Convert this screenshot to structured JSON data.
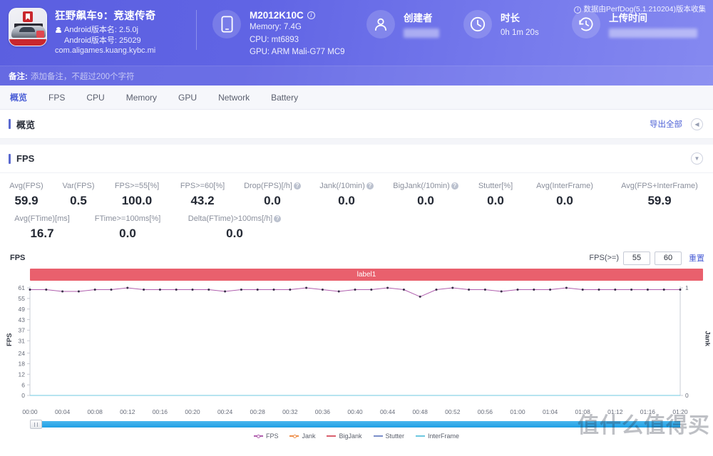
{
  "header": {
    "app_name": "狂野飙车9：竞速传奇",
    "android_version_name_line": "Android版本名: 2.5.0j",
    "android_version_code_line": "Android版本号: 25029",
    "package": "com.aligames.kuang.kybc.mi",
    "device": {
      "model": "M2012K10C",
      "memory": "Memory: 7.4G",
      "cpu": "CPU: mt6893",
      "gpu": "GPU: ARM Mali-G77 MC9"
    },
    "creator": {
      "title": "创建者",
      "value": ""
    },
    "duration": {
      "title": "时长",
      "value": "0h 1m 20s"
    },
    "upload": {
      "title": "上传时间",
      "value": ""
    },
    "perfdog_note": "数据由PerfDog(5.1.210204)版本收集",
    "note_label": "备注:",
    "note_placeholder": "添加备注，不超过200个字符"
  },
  "tabs": [
    {
      "label": "概览",
      "active": true
    },
    {
      "label": "FPS",
      "active": false
    },
    {
      "label": "CPU",
      "active": false
    },
    {
      "label": "Memory",
      "active": false
    },
    {
      "label": "GPU",
      "active": false
    },
    {
      "label": "Network",
      "active": false
    },
    {
      "label": "Battery",
      "active": false
    }
  ],
  "overview_panel": {
    "title": "概览",
    "export_all": "导出全部",
    "collapse_icon": "chevron-left-icon"
  },
  "fps_panel": {
    "title": "FPS",
    "collapse_icon": "chevron-down-icon"
  },
  "metrics": [
    {
      "label": "Avg(FPS)",
      "value": "59.9",
      "help": false
    },
    {
      "label": "Var(FPS)",
      "value": "0.5",
      "help": false
    },
    {
      "label": "FPS>=55[%]",
      "value": "100.0",
      "help": false
    },
    {
      "label": "FPS>=60[%]",
      "value": "43.2",
      "help": false
    },
    {
      "label": "Drop(FPS)[/h]",
      "value": "0.0",
      "help": true
    },
    {
      "label": "Jank(/10min)",
      "value": "0.0",
      "help": true
    },
    {
      "label": "BigJank(/10min)",
      "value": "0.0",
      "help": true
    },
    {
      "label": "Stutter[%]",
      "value": "0.0",
      "help": false
    },
    {
      "label": "Avg(InterFrame)",
      "value": "0.0",
      "help": false
    },
    {
      "label": "Avg(FPS+InterFrame)",
      "value": "59.9",
      "help": false
    }
  ],
  "metrics2": [
    {
      "label": "Avg(FTime)[ms]",
      "value": "16.7",
      "help": false
    },
    {
      "label": "FTime>=100ms[%]",
      "value": "0.0",
      "help": false
    },
    {
      "label": "Delta(FTime)>100ms[/h]",
      "value": "0.0",
      "help": true
    }
  ],
  "chart_controls": {
    "chart_label": "FPS",
    "threshold_label": "FPS(>=)",
    "threshold_1": "55",
    "threshold_2": "60",
    "reset": "重置",
    "band_label": "label1"
  },
  "watermark": "值什么值得买",
  "chart_data": {
    "type": "line",
    "title": "FPS",
    "xlabel": "",
    "ylabel": "FPS",
    "y2label": "Jank",
    "ylim": [
      0,
      61
    ],
    "y2lim": [
      0,
      1
    ],
    "yticks": [
      0,
      6,
      12,
      18,
      24,
      31,
      37,
      43,
      49,
      55,
      61
    ],
    "y2ticks": [
      0,
      1
    ],
    "grid": false,
    "legend_position": "bottom",
    "xticks": [
      "00:00",
      "00:04",
      "00:08",
      "00:12",
      "00:16",
      "00:20",
      "00:24",
      "00:28",
      "00:32",
      "00:36",
      "00:40",
      "00:44",
      "00:48",
      "00:52",
      "00:56",
      "01:00",
      "01:04",
      "01:08",
      "01:12",
      "01:16",
      "01:20"
    ],
    "x": [
      0,
      2,
      4,
      6,
      8,
      10,
      12,
      14,
      16,
      18,
      20,
      22,
      24,
      26,
      28,
      30,
      32,
      34,
      36,
      38,
      40,
      42,
      44,
      46,
      48,
      50,
      52,
      54,
      56,
      58,
      60,
      62,
      64,
      66,
      68,
      70,
      72,
      74,
      76,
      78,
      80
    ],
    "series": [
      {
        "name": "FPS",
        "color": "#b05fae",
        "values": [
          60,
          60,
          59,
          59,
          60,
          60,
          61,
          60,
          60,
          60,
          60,
          60,
          59,
          60,
          60,
          60,
          60,
          61,
          60,
          59,
          60,
          60,
          61,
          60,
          56,
          60,
          61,
          60,
          60,
          59,
          60,
          60,
          60,
          61,
          60,
          60,
          60,
          60,
          60,
          60,
          60
        ]
      },
      {
        "name": "Jank",
        "color": "#ee8f4a",
        "values": [
          0,
          0,
          0,
          0,
          0,
          0,
          0,
          0,
          0,
          0,
          0,
          0,
          0,
          0,
          0,
          0,
          0,
          0,
          0,
          0,
          0,
          0,
          0,
          0,
          0,
          0,
          0,
          0,
          0,
          0,
          0,
          0,
          0,
          0,
          0,
          0,
          0,
          0,
          0,
          0,
          0
        ]
      },
      {
        "name": "BigJank",
        "color": "#d9606e",
        "values": [
          0,
          0,
          0,
          0,
          0,
          0,
          0,
          0,
          0,
          0,
          0,
          0,
          0,
          0,
          0,
          0,
          0,
          0,
          0,
          0,
          0,
          0,
          0,
          0,
          0,
          0,
          0,
          0,
          0,
          0,
          0,
          0,
          0,
          0,
          0,
          0,
          0,
          0,
          0,
          0,
          0
        ]
      },
      {
        "name": "Stutter",
        "color": "#7b8fc9",
        "values": [
          0,
          0,
          0,
          0,
          0,
          0,
          0,
          0,
          0,
          0,
          0,
          0,
          0,
          0,
          0,
          0,
          0,
          0,
          0,
          0,
          0,
          0,
          0,
          0,
          0,
          0,
          0,
          0,
          0,
          0,
          0,
          0,
          0,
          0,
          0,
          0,
          0,
          0,
          0,
          0,
          0
        ]
      },
      {
        "name": "InterFrame",
        "color": "#6ec8e0",
        "values": [
          0,
          0,
          0,
          0,
          0,
          0,
          0,
          0,
          0,
          0,
          0,
          0,
          0,
          0,
          0,
          0,
          0,
          0,
          0,
          0,
          0,
          0,
          0,
          0,
          0,
          0,
          0,
          0,
          0,
          0,
          0,
          0,
          0,
          0,
          0,
          0,
          0,
          0,
          0,
          0,
          0
        ]
      }
    ],
    "legend": [
      {
        "name": "FPS",
        "color": "#b05fae",
        "marker": "line-dot"
      },
      {
        "name": "Jank",
        "color": "#ee8f4a",
        "marker": "line-dot"
      },
      {
        "name": "BigJank",
        "color": "#d9606e",
        "marker": "line"
      },
      {
        "name": "Stutter",
        "color": "#7b8fc9",
        "marker": "line"
      },
      {
        "name": "InterFrame",
        "color": "#6ec8e0",
        "marker": "line"
      }
    ]
  },
  "colors": {
    "header_accent": "#6064e4",
    "link": "#4b5fd6",
    "band": "#e9606d"
  }
}
